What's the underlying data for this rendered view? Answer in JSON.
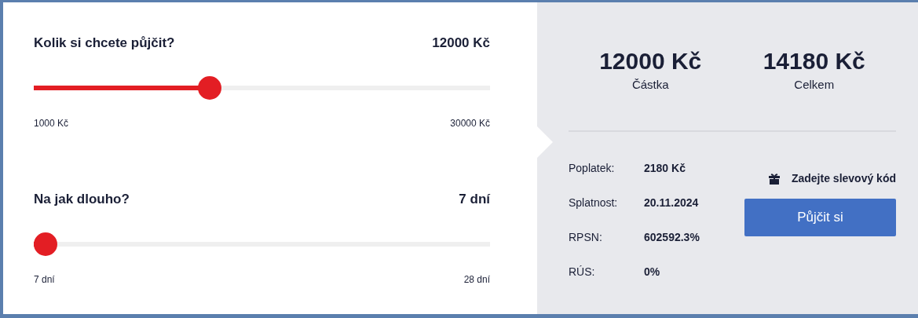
{
  "sliders": [
    {
      "question": "Kolik si chcete půjčit?",
      "value": "12000 Kč",
      "level": 0.379,
      "min_label": "1000 Kč",
      "max_label": "30000 Kč"
    },
    {
      "question": "Na jak dlouho?",
      "value": "7 dní",
      "level": 0,
      "min_label": "7 dní",
      "max_label": "28 dní"
    }
  ],
  "summary": [
    {
      "amount": "12000 Kč",
      "label": "Částka"
    },
    {
      "amount": "14180 Kč",
      "label": "Celkem"
    }
  ],
  "details": [
    {
      "label": "Poplatek:",
      "value": "2180 Kč"
    },
    {
      "label": "Splatnost:",
      "value": "20.11.2024"
    },
    {
      "label": "RPSN:",
      "value": "602592.3%"
    },
    {
      "label": "RÚS:",
      "value": "0%"
    }
  ],
  "discount_link": "Zadejte slevový kód",
  "submit_button": "Půjčit si"
}
